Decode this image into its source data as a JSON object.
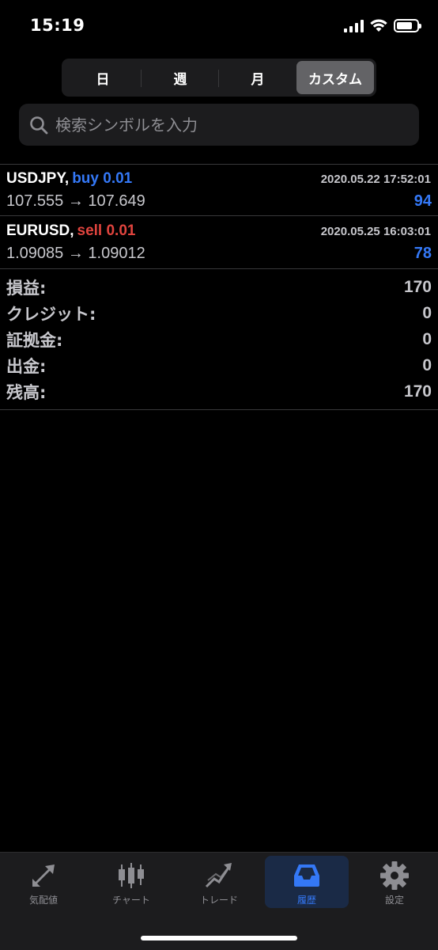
{
  "status": {
    "time": "15:19"
  },
  "segments": [
    {
      "label": "日"
    },
    {
      "label": "週"
    },
    {
      "label": "月"
    },
    {
      "label": "カスタム",
      "active": true
    }
  ],
  "search": {
    "placeholder": "検索シンボルを入力"
  },
  "trades": [
    {
      "symbol": "USDJPY,",
      "side": "buy 0.01",
      "time": "2020.05.22 17:52:01",
      "prices": "107.555 → 107.649",
      "profit": "94"
    },
    {
      "symbol": "EURUSD,",
      "side": "sell 0.01",
      "time": "2020.05.25 16:03:01",
      "prices": "1.09085 → 1.09012",
      "profit": "78"
    }
  ],
  "summary": [
    {
      "label": "損益:",
      "value": "170"
    },
    {
      "label": "クレジット:",
      "value": "0"
    },
    {
      "label": "証拠金:",
      "value": "0"
    },
    {
      "label": "出金:",
      "value": "0"
    },
    {
      "label": "残高:",
      "value": "170"
    }
  ],
  "tabs": [
    {
      "label": "気配値",
      "icon": "quotes-arrows-icon"
    },
    {
      "label": "チャート",
      "icon": "candlestick-icon"
    },
    {
      "label": "トレード",
      "icon": "trade-chart-icon"
    },
    {
      "label": "履歴",
      "icon": "inbox-tray-icon",
      "active": true
    },
    {
      "label": "設定",
      "icon": "gear-icon"
    }
  ],
  "colors": {
    "accent": "#3478f6",
    "sell": "#e0443e",
    "background": "#000000",
    "surface": "#1c1c1e"
  }
}
